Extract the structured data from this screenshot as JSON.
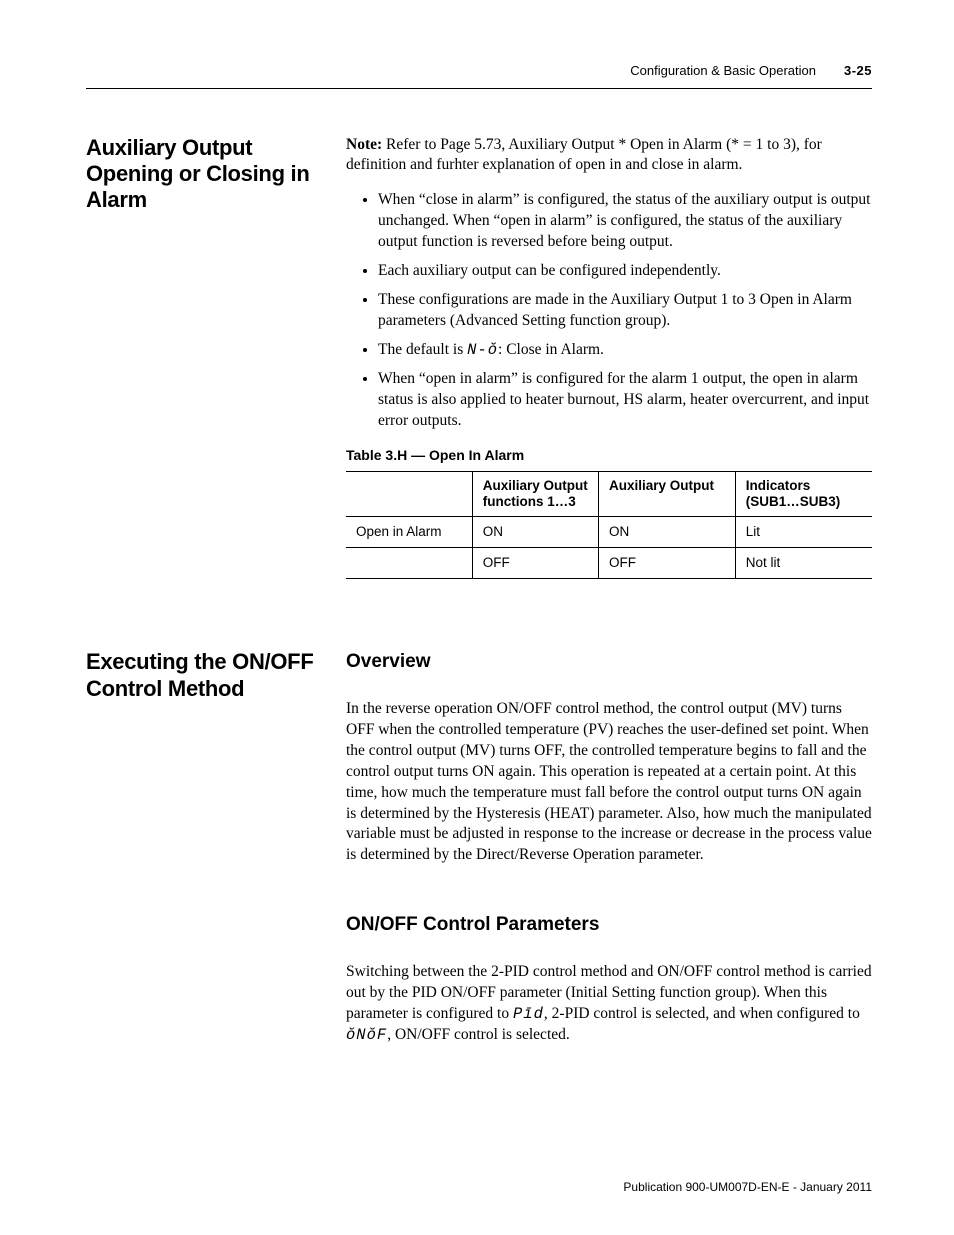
{
  "header": {
    "section": "Configuration & Basic Operation",
    "page": "3-25"
  },
  "section1": {
    "title": "Auxiliary Output Opening or Closing in Alarm",
    "note_label": "Note:",
    "note_text": " Refer to Page 5.73, Auxiliary Output * Open in Alarm (* = 1 to 3), for definition and furhter explanation of open in and close in alarm.",
    "bullets": [
      "When “close in alarm” is configured, the status of the auxiliary output is output unchanged. When “open in alarm” is configured, the status of the auxiliary output function is reversed before being output.",
      "Each auxiliary output can be configured independently.",
      "These configurations are made in the Auxiliary Output 1 to 3 Open in Alarm parameters (Advanced Setting function group)."
    ],
    "bullet_default_pre": "The default is ",
    "bullet_default_seg": "N-ŏ",
    "bullet_default_post": ": Close in Alarm.",
    "bullet_last": "When “open in alarm” is configured for the alarm 1 output, the open in alarm status is also applied to heater burnout, HS alarm, heater overcurrent, and input error outputs.",
    "table": {
      "caption": "Table 3.H — Open In Alarm",
      "headers": [
        "",
        "Auxiliary Output functions 1…3",
        "Auxiliary Output",
        "Indicators (SUB1…SUB3)"
      ],
      "rows": [
        [
          "Open in Alarm",
          "ON",
          "ON",
          "Lit"
        ],
        [
          "",
          "OFF",
          "OFF",
          "Not lit"
        ]
      ]
    }
  },
  "section2": {
    "title": "Executing the ON/OFF Control Method",
    "overview_h": "Overview",
    "overview_p": "In the reverse operation ON/OFF control method, the control output (MV) turns OFF when the controlled temperature (PV) reaches the user-defined set point. When the control output (MV) turns OFF, the controlled temperature begins to fall and the control output turns ON again. This operation is repeated at a certain point. At this time, how much the temperature must fall before the control output turns ON again is determined by the Hysteresis (HEAT) parameter. Also, how much the manipulated variable must be adjusted in response to the increase or decrease in the process value is determined by the Direct/Reverse Operation parameter.",
    "params_h": "ON/OFF Control Parameters",
    "params_pre": "Switching between the 2-PID control method and ON/OFF control method is carried out by the PID ON/OFF parameter (Initial Setting function group). When this parameter is configured to ",
    "params_pid": "Pīd",
    "params_mid": ", 2-PID control is selected, and when configured to ",
    "params_onof": "ŏNŏF",
    "params_post": ", ON/OFF control is selected."
  },
  "footer": {
    "pub": "Publication 900-UM007D-EN-E - January 2011"
  }
}
